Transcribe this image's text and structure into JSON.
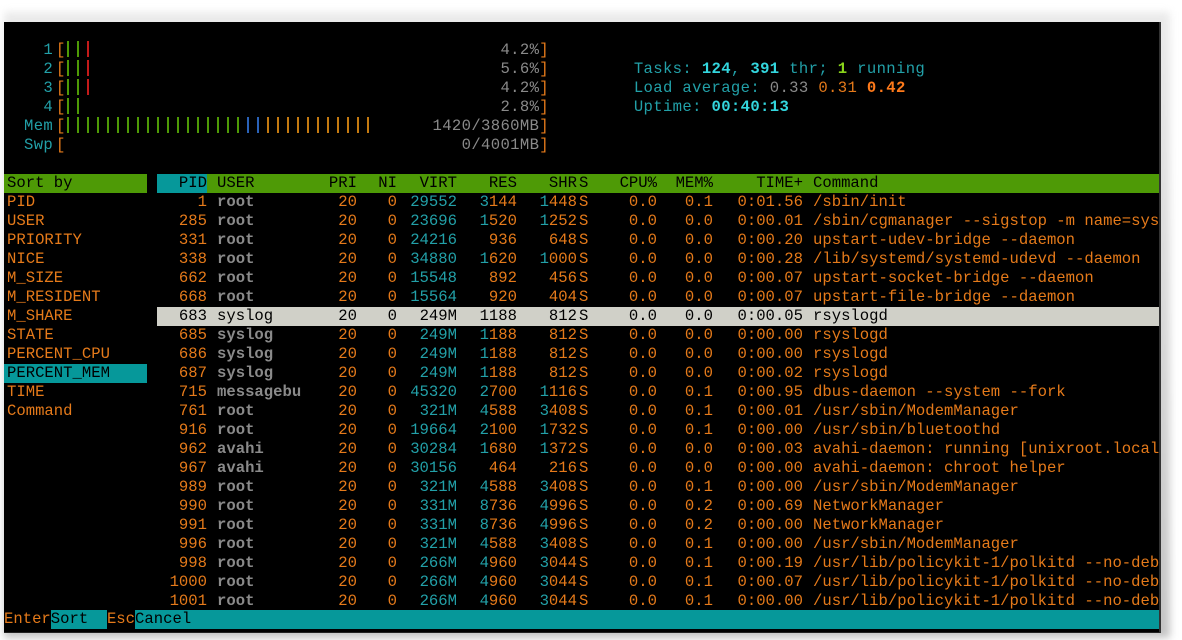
{
  "meters": {
    "cpus": [
      {
        "label": "1",
        "percent": "4.2%",
        "bars": [
          "green",
          "green",
          "red"
        ]
      },
      {
        "label": "2",
        "percent": "5.6%",
        "bars": [
          "green",
          "green",
          "red"
        ]
      },
      {
        "label": "3",
        "percent": "4.2%",
        "bars": [
          "green",
          "green",
          "red"
        ]
      },
      {
        "label": "4",
        "percent": "2.8%",
        "bars": [
          "green",
          "green"
        ]
      }
    ],
    "mem": {
      "label": "Mem",
      "value": "1420/3860MB",
      "used_fraction": 0.368,
      "bar_counts": {
        "green": 18,
        "blue": 2,
        "amber": 11
      }
    },
    "swp": {
      "label": "Swp",
      "value": "0/4001MB",
      "used_fraction": 0.0
    }
  },
  "summary": {
    "tasks_label": "Tasks: ",
    "tasks": "124",
    "sep1": ", ",
    "threads": "391",
    "thr_label": " thr; ",
    "running": "1",
    "running_label": " running",
    "load_label": "Load average: ",
    "load1": "0.33",
    "load5": "0.31",
    "load15": "0.42",
    "uptime_label": "Uptime: ",
    "uptime": "00:40:13"
  },
  "sort_panel": {
    "title": "Sort by",
    "selected_index": 9,
    "items": [
      "PID",
      "USER",
      "PRIORITY",
      "NICE",
      "M_SIZE",
      "M_RESIDENT",
      "M_SHARE",
      "STATE",
      "PERCENT_CPU",
      "PERCENT_MEM",
      "TIME",
      "Command"
    ]
  },
  "table": {
    "columns": [
      "PID",
      "USER",
      "PRI",
      "NI",
      "VIRT",
      "RES",
      "SHR",
      "S",
      "CPU%",
      "MEM%",
      "TIME+",
      "Command"
    ],
    "selected_row": 6,
    "rows": [
      [
        "1",
        "root",
        "20",
        "0",
        "29552",
        "3144",
        "1448",
        "S",
        "0.0",
        "0.1",
        "0:01.56",
        "/sbin/init"
      ],
      [
        "285",
        "root",
        "20",
        "0",
        "23696",
        "1520",
        "1252",
        "S",
        "0.0",
        "0.0",
        "0:00.01",
        "/sbin/cgmanager --sigstop -m name=sys"
      ],
      [
        "331",
        "root",
        "20",
        "0",
        "24216",
        "936",
        "648",
        "S",
        "0.0",
        "0.0",
        "0:00.20",
        "upstart-udev-bridge --daemon"
      ],
      [
        "338",
        "root",
        "20",
        "0",
        "34880",
        "1620",
        "1000",
        "S",
        "0.0",
        "0.0",
        "0:00.28",
        "/lib/systemd/systemd-udevd --daemon"
      ],
      [
        "662",
        "root",
        "20",
        "0",
        "15548",
        "892",
        "456",
        "S",
        "0.0",
        "0.0",
        "0:00.07",
        "upstart-socket-bridge --daemon"
      ],
      [
        "668",
        "root",
        "20",
        "0",
        "15564",
        "920",
        "404",
        "S",
        "0.0",
        "0.0",
        "0:00.07",
        "upstart-file-bridge --daemon"
      ],
      [
        "683",
        "syslog",
        "20",
        "0",
        "249M",
        "1188",
        "812",
        "S",
        "0.0",
        "0.0",
        "0:00.05",
        "rsyslogd"
      ],
      [
        "685",
        "syslog",
        "20",
        "0",
        "249M",
        "1188",
        "812",
        "S",
        "0.0",
        "0.0",
        "0:00.00",
        "rsyslogd"
      ],
      [
        "686",
        "syslog",
        "20",
        "0",
        "249M",
        "1188",
        "812",
        "S",
        "0.0",
        "0.0",
        "0:00.00",
        "rsyslogd"
      ],
      [
        "687",
        "syslog",
        "20",
        "0",
        "249M",
        "1188",
        "812",
        "S",
        "0.0",
        "0.0",
        "0:00.02",
        "rsyslogd"
      ],
      [
        "715",
        "messagebu",
        "20",
        "0",
        "45320",
        "2700",
        "1116",
        "S",
        "0.0",
        "0.1",
        "0:00.95",
        "dbus-daemon --system --fork"
      ],
      [
        "761",
        "root",
        "20",
        "0",
        "321M",
        "4588",
        "3408",
        "S",
        "0.0",
        "0.1",
        "0:00.01",
        "/usr/sbin/ModemManager"
      ],
      [
        "916",
        "root",
        "20",
        "0",
        "19664",
        "2100",
        "1732",
        "S",
        "0.0",
        "0.1",
        "0:00.00",
        "/usr/sbin/bluetoothd"
      ],
      [
        "962",
        "avahi",
        "20",
        "0",
        "30284",
        "1680",
        "1372",
        "S",
        "0.0",
        "0.0",
        "0:00.03",
        "avahi-daemon: running [unixroot.local"
      ],
      [
        "967",
        "avahi",
        "20",
        "0",
        "30156",
        "464",
        "216",
        "S",
        "0.0",
        "0.0",
        "0:00.00",
        "avahi-daemon: chroot helper"
      ],
      [
        "989",
        "root",
        "20",
        "0",
        "321M",
        "4588",
        "3408",
        "S",
        "0.0",
        "0.1",
        "0:00.00",
        "/usr/sbin/ModemManager"
      ],
      [
        "990",
        "root",
        "20",
        "0",
        "331M",
        "8736",
        "4996",
        "S",
        "0.0",
        "0.2",
        "0:00.69",
        "NetworkManager"
      ],
      [
        "991",
        "root",
        "20",
        "0",
        "331M",
        "8736",
        "4996",
        "S",
        "0.0",
        "0.2",
        "0:00.00",
        "NetworkManager"
      ],
      [
        "996",
        "root",
        "20",
        "0",
        "321M",
        "4588",
        "3408",
        "S",
        "0.0",
        "0.1",
        "0:00.00",
        "/usr/sbin/ModemManager"
      ],
      [
        "998",
        "root",
        "20",
        "0",
        "266M",
        "4960",
        "3044",
        "S",
        "0.0",
        "0.1",
        "0:00.19",
        "/usr/lib/policykit-1/polkitd --no-deb"
      ],
      [
        "1000",
        "root",
        "20",
        "0",
        "266M",
        "4960",
        "3044",
        "S",
        "0.0",
        "0.1",
        "0:00.07",
        "/usr/lib/policykit-1/polkitd --no-deb"
      ],
      [
        "1001",
        "root",
        "20",
        "0",
        "266M",
        "4960",
        "3044",
        "S",
        "0.0",
        "0.1",
        "0:00.00",
        "/usr/lib/policykit-1/polkitd --no-deb"
      ]
    ]
  },
  "footer": [
    {
      "key": "Enter",
      "label": "Sort  "
    },
    {
      "key": "Esc",
      "label": "Cancel"
    }
  ],
  "colors": {
    "header_bg": "#4e9a06",
    "selection_bg": "#06989a",
    "row_highlight_bg": "#d0d0c8",
    "orange": "#e57a1a",
    "cyan": "#22a0a8"
  }
}
